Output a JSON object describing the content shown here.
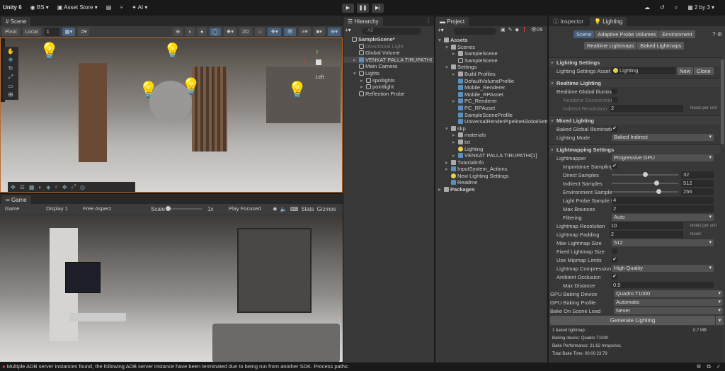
{
  "topbar": {
    "app": "Unity 6",
    "account": "BS",
    "asset_store": "Asset Store",
    "ai": "AI",
    "layout": "2 by 3"
  },
  "scene": {
    "tab": "Scene",
    "pivot": "Pivot",
    "local": "Local",
    "grid_value": "1",
    "persp_label": "Left"
  },
  "game": {
    "tab": "Game",
    "mode": "Game",
    "display": "Display 1",
    "aspect": "Free Aspect",
    "scale_label": "Scale",
    "scale_value": "1x",
    "play_mode": "Play Focused",
    "stats": "Stats",
    "gizmos": "Gizmos"
  },
  "hierarchy": {
    "tab": "Hierarchy",
    "search_placeholder": "All",
    "items": [
      {
        "label": "SampleScene*",
        "depth": 0,
        "kind": "scene",
        "bold": true
      },
      {
        "label": "Directional Light",
        "depth": 1,
        "kind": "obj",
        "dim": true
      },
      {
        "label": "Global Volume",
        "depth": 1,
        "kind": "obj"
      },
      {
        "label": "VENKAT PALLA TIRUPATHI",
        "depth": 1,
        "kind": "asset",
        "selected": true,
        "arrow": "▸"
      },
      {
        "label": "Main Camera",
        "depth": 1,
        "kind": "obj"
      },
      {
        "label": "Lights",
        "depth": 1,
        "kind": "obj",
        "arrow": "▾"
      },
      {
        "label": "spotlights",
        "depth": 2,
        "kind": "obj",
        "arrow": "▸"
      },
      {
        "label": "pointlight",
        "depth": 2,
        "kind": "obj",
        "arrow": "▸"
      },
      {
        "label": "Reflection Probe",
        "depth": 1,
        "kind": "obj"
      }
    ]
  },
  "project": {
    "tab": "Project",
    "count": "29",
    "items": [
      {
        "label": "Assets",
        "depth": 0,
        "kind": "folder",
        "arrow": "▾",
        "bold": true
      },
      {
        "label": "Scenes",
        "depth": 1,
        "kind": "folder",
        "arrow": "▾"
      },
      {
        "label": "SampleScene",
        "depth": 2,
        "kind": "folder",
        "arrow": "▸"
      },
      {
        "label": "SampleScene",
        "depth": 2,
        "kind": "obj"
      },
      {
        "label": "Settings",
        "depth": 1,
        "kind": "folder",
        "arrow": "▾"
      },
      {
        "label": "Build Profiles",
        "depth": 2,
        "kind": "folder",
        "arrow": "▸"
      },
      {
        "label": "DefaultVolumeProfile",
        "depth": 2,
        "kind": "asset"
      },
      {
        "label": "Mobile_Renderer",
        "depth": 2,
        "kind": "asset"
      },
      {
        "label": "Mobile_RPAsset",
        "depth": 2,
        "kind": "asset"
      },
      {
        "label": "PC_Renderer",
        "depth": 2,
        "kind": "asset",
        "arrow": "▸"
      },
      {
        "label": "PC_RPAsset",
        "depth": 2,
        "kind": "asset"
      },
      {
        "label": "SampleSceneProfile",
        "depth": 2,
        "kind": "asset"
      },
      {
        "label": "UniversalRenderPipelineGlobalSettings",
        "depth": 2,
        "kind": "asset"
      },
      {
        "label": "skp",
        "depth": 1,
        "kind": "folder",
        "arrow": "▾"
      },
      {
        "label": "materials",
        "depth": 2,
        "kind": "folder",
        "arrow": "▸"
      },
      {
        "label": "txt",
        "depth": 2,
        "kind": "folder",
        "arrow": "▸"
      },
      {
        "label": "Lighting",
        "depth": 2,
        "kind": "bulb"
      },
      {
        "label": "VENKAT PALLA TIRUPATHI[1]",
        "depth": 2,
        "kind": "asset",
        "arrow": "▸"
      },
      {
        "label": "TutorialInfo",
        "depth": 1,
        "kind": "folder",
        "arrow": "▸"
      },
      {
        "label": "InputSystem_Actions",
        "depth": 1,
        "kind": "asset",
        "arrow": "▸"
      },
      {
        "label": "New Lighting Settings",
        "depth": 1,
        "kind": "bulb"
      },
      {
        "label": "Readme",
        "depth": 1,
        "kind": "asset"
      },
      {
        "label": "Packages",
        "depth": 0,
        "kind": "folder",
        "arrow": "▸",
        "bold": true
      }
    ]
  },
  "inspector": {
    "tab_inspector": "Inspector",
    "tab_lighting": "Lighting",
    "subtabs": [
      "Scene",
      "Adaptive Probe Volumes",
      "Environment"
    ],
    "subtabs2": [
      "Realtime Lightmaps",
      "Baked Lightmaps"
    ],
    "sections": [
      {
        "title": "Lighting Settings",
        "rows": [
          {
            "label": "Lighting Settings Asset",
            "type": "asset",
            "value": "Lighting",
            "btn1": "New",
            "btn2": "Clone"
          }
        ]
      },
      {
        "title": "Realtime Lighting",
        "rows": [
          {
            "label": "Realtime Global Illumination",
            "type": "check",
            "value": ""
          },
          {
            "label": "Realtime Environment Lighting",
            "type": "check",
            "value": "",
            "indent": true,
            "dis": true
          },
          {
            "label": "Indirect Resolution",
            "type": "field",
            "value": "2",
            "suffix": "texels per unit",
            "indent": true,
            "dis": true
          }
        ]
      },
      {
        "title": "Mixed Lighting",
        "rows": [
          {
            "label": "Baked Global Illumination",
            "type": "check",
            "value": "✔"
          },
          {
            "label": "Lighting Mode",
            "type": "drop",
            "value": "Baked Indirect"
          }
        ]
      },
      {
        "title": "Lightmapping Settings",
        "rows": [
          {
            "label": "Lightmapper",
            "type": "drop",
            "value": "Progressive GPU"
          },
          {
            "label": "Importance Sampling",
            "type": "check",
            "value": "✔",
            "indent": true
          },
          {
            "label": "Direct Samples",
            "type": "slider",
            "value": "32",
            "fraction": 0.5,
            "indent": true
          },
          {
            "label": "Indirect Samples",
            "type": "slider",
            "value": "512",
            "fraction": 0.67,
            "indent": true
          },
          {
            "label": "Environment Samples",
            "type": "slider",
            "value": "256",
            "fraction": 0.7,
            "indent": true
          },
          {
            "label": "Light Probe Sample Multiplier",
            "type": "field",
            "value": "4",
            "indent": true
          },
          {
            "label": "Max Bounces",
            "type": "field",
            "value": "2",
            "indent": true
          },
          {
            "label": "Filtering",
            "type": "drop",
            "value": "Auto",
            "indent": true
          },
          {
            "label": "Lightmap Resolution",
            "type": "field",
            "value": "10",
            "suffix": "texels per unit"
          },
          {
            "label": "Lightmap Padding",
            "type": "field",
            "value": "2",
            "suffix": "texels"
          },
          {
            "label": "Max Lightmap Size",
            "type": "drop",
            "value": "512"
          },
          {
            "label": "Fixed Lightmap Size",
            "type": "check",
            "value": ""
          },
          {
            "label": "Use Mipmap Limits",
            "type": "check",
            "value": "✔"
          },
          {
            "label": "Lightmap Compression",
            "type": "drop",
            "value": "High Quality"
          },
          {
            "label": "Ambient Occlusion",
            "type": "check",
            "value": "✔"
          },
          {
            "label": "Max Distance",
            "type": "field",
            "value": "0.5",
            "indent": true
          }
        ]
      }
    ],
    "bottom": [
      {
        "label": "GPU Baking Device",
        "value": "Quadro T1000"
      },
      {
        "label": "GPU Baking Profile",
        "value": "Automatic"
      },
      {
        "label": "Bake On Scene Load",
        "value": "Never"
      }
    ],
    "generate": "Generate Lighting",
    "stats": {
      "lightmaps": "1 baked lightmap:",
      "size": "0.7 MB",
      "device": "Baking device: Quadro T1000",
      "perf": "Bake Performance: 21.62 mrays/sec",
      "time": "Total Bake Time: 00:00:23.79"
    }
  },
  "status": {
    "message": "Multiple ADB server instances found, the following ADB server instance have been terminated due to being run from another SDK. Process paths:"
  }
}
